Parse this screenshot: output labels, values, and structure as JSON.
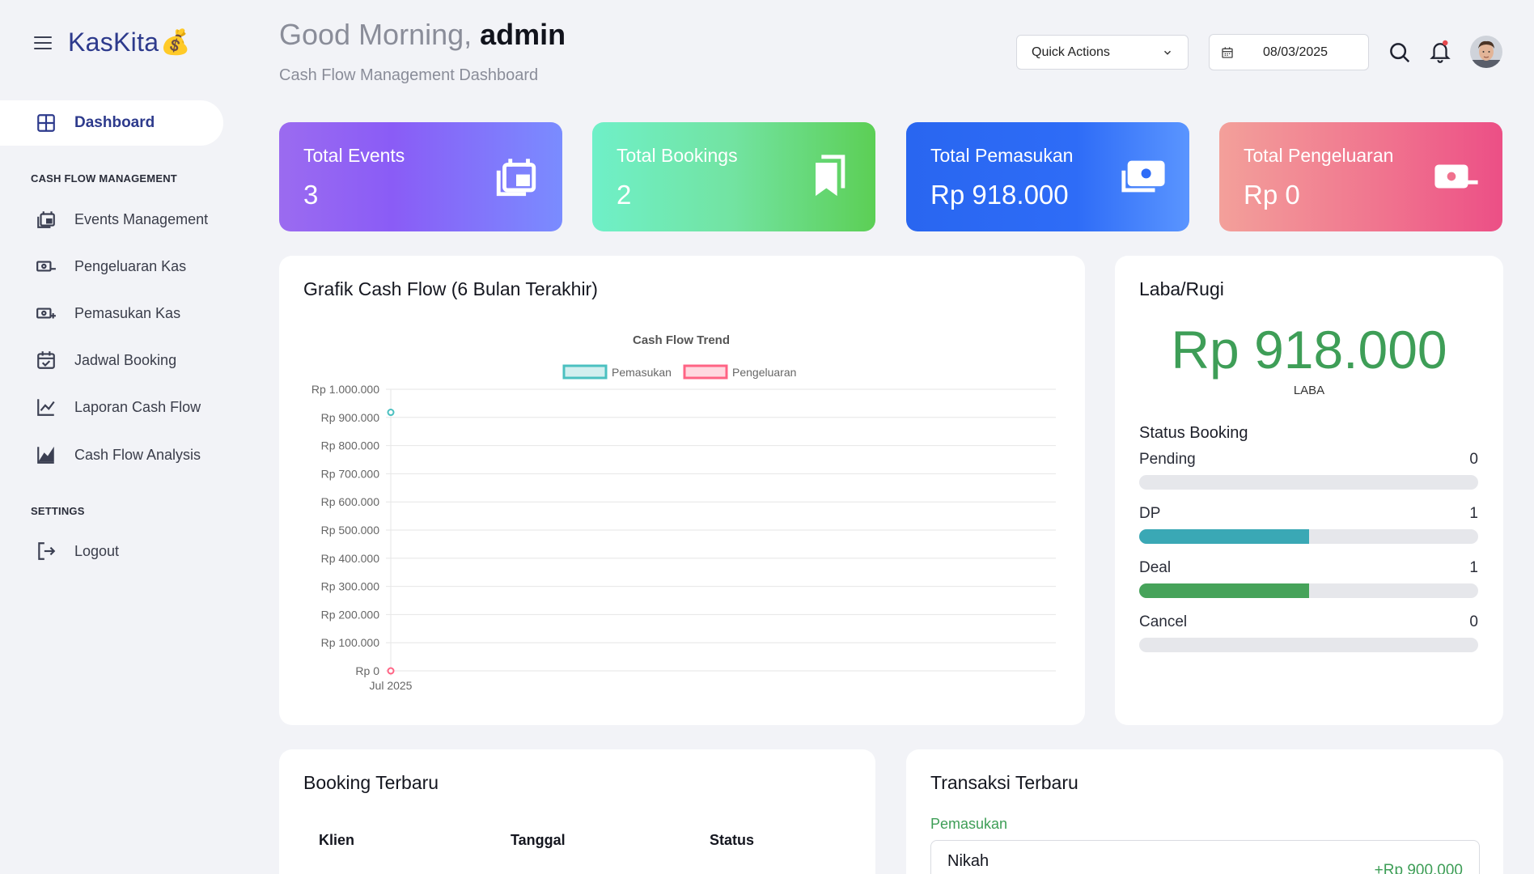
{
  "brand": {
    "name": "KasKita",
    "emoji": "💰"
  },
  "nav": {
    "active": {
      "label": "Dashboard",
      "icon": "dashboard-grid-icon"
    },
    "section_cash": "CASH FLOW MANAGEMENT",
    "items": [
      {
        "label": "Events Management",
        "icon": "events-icon"
      },
      {
        "label": "Pengeluaran Kas",
        "icon": "cash-minus-icon"
      },
      {
        "label": "Pemasukan Kas",
        "icon": "cash-plus-icon"
      },
      {
        "label": "Jadwal Booking",
        "icon": "calendar-check-icon"
      },
      {
        "label": "Laporan Cash Flow",
        "icon": "line-chart-icon"
      },
      {
        "label": "Cash Flow Analysis",
        "icon": "area-chart-icon"
      }
    ],
    "section_settings": "SETTINGS",
    "logout": {
      "label": "Logout",
      "icon": "logout-icon"
    }
  },
  "header": {
    "greeting_prefix": "Good Morning,",
    "user": "admin",
    "subtitle": "Cash Flow Management Dashboard",
    "quick_actions": "Quick Actions",
    "date": "08/03/2025"
  },
  "stats": {
    "events": {
      "title": "Total Events",
      "value": "3"
    },
    "bookings": {
      "title": "Total Bookings",
      "value": "2"
    },
    "pemasukan": {
      "title": "Total Pemasukan",
      "value": "Rp 918.000"
    },
    "pengeluaran": {
      "title": "Total Pengeluaran",
      "value": "Rp 0"
    }
  },
  "chart_panel": {
    "title": "Grafik Cash Flow (6 Bulan Terakhir)"
  },
  "chart_data": {
    "type": "line",
    "title": "Cash Flow Trend",
    "categories": [
      "Jul 2025"
    ],
    "series": [
      {
        "name": "Pemasukan",
        "values": [
          918000
        ],
        "color": "#4bc0c0"
      },
      {
        "name": "Pengeluaran",
        "values": [
          0
        ],
        "color": "#ff6384"
      }
    ],
    "ylim": [
      0,
      1000000
    ],
    "yticks": [
      "Rp 0",
      "Rp 100.000",
      "Rp 200.000",
      "Rp 300.000",
      "Rp 400.000",
      "Rp 500.000",
      "Rp 600.000",
      "Rp 700.000",
      "Rp 800.000",
      "Rp 900.000",
      "Rp 1.000.000"
    ],
    "legend": "top",
    "grid": true
  },
  "laba": {
    "title": "Laba/Rugi",
    "amount": "Rp 918.000",
    "label": "LABA",
    "status_title": "Status Booking",
    "statuses": [
      {
        "label": "Pending",
        "count": "0",
        "fraction": 0,
        "color": "#4bb3b3"
      },
      {
        "label": "DP",
        "count": "1",
        "fraction": 0.5,
        "color": "#3aa8b5"
      },
      {
        "label": "Deal",
        "count": "1",
        "fraction": 0.5,
        "color": "#46a35a"
      },
      {
        "label": "Cancel",
        "count": "0",
        "fraction": 0,
        "color": "#e05260"
      }
    ]
  },
  "booking": {
    "title": "Booking Terbaru",
    "columns": [
      "Klien",
      "Tanggal",
      "Status"
    ]
  },
  "transaksi": {
    "title": "Transaksi Terbaru",
    "subheading": "Pemasukan",
    "item_name": "Nikah",
    "item_amount": "+Rp 900.000"
  }
}
